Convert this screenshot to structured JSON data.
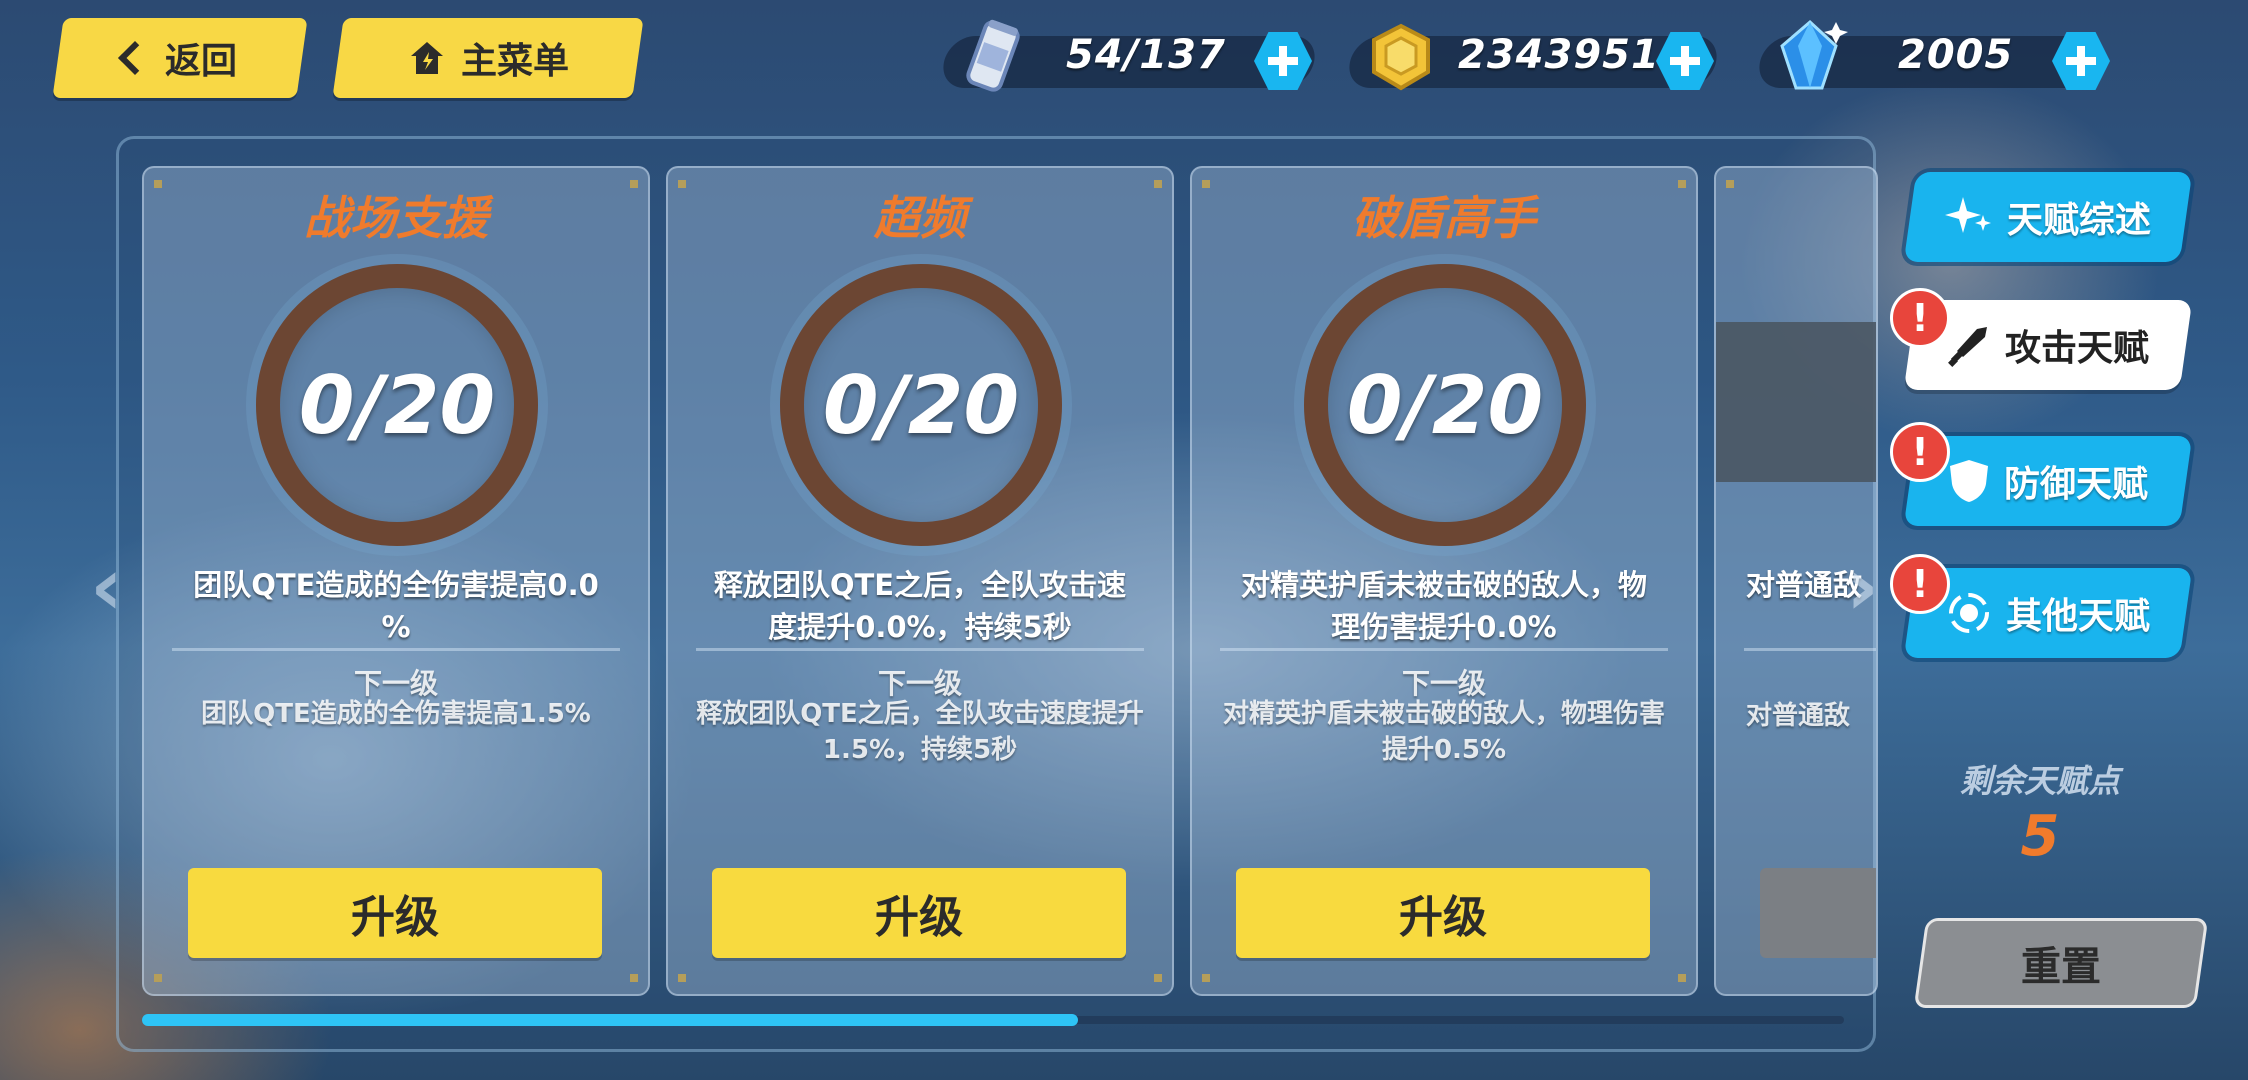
{
  "nav": {
    "back_label": "返回",
    "menu_label": "主菜单"
  },
  "resources": {
    "stamina": {
      "value": "54/137",
      "icon": "stamina-drink-icon"
    },
    "coins": {
      "value": "2343951",
      "icon": "coin-icon"
    },
    "crystals": {
      "value": "2005",
      "icon": "crystal-icon"
    }
  },
  "cards": [
    {
      "title": "战场支援",
      "level": "0/20",
      "progress": 0,
      "desc_line1": "团队QTE造成的全伤害提高0.0",
      "desc_line2": "%",
      "next_label": "下一级",
      "next_line1": "团队QTE造成的全伤害提高1.5%",
      "next_line2": "",
      "button": "升级"
    },
    {
      "title": "超频",
      "level": "0/20",
      "progress": 0,
      "desc_line1": "释放团队QTE之后，全队攻击速",
      "desc_line2": "度提升0.0%，持续5秒",
      "next_label": "下一级",
      "next_line1": "释放团队QTE之后，全队攻击速度提升",
      "next_line2": "1.5%，持续5秒",
      "button": "升级"
    },
    {
      "title": "破盾高手",
      "level": "0/20",
      "progress": 0,
      "desc_line1": "对精英护盾未被击破的敌人，物",
      "desc_line2": "理伤害提升0.0%",
      "next_label": "下一级",
      "next_line1": "对精英护盾未被击破的敌人，物理伤害",
      "next_line2": "提升0.5%",
      "button": "升级"
    }
  ],
  "partial_card": {
    "desc": "对普通敌",
    "next": "对普通敌"
  },
  "arrows": {
    "left": "‹",
    "right": "›"
  },
  "scroll_progress": 0.55,
  "side_tabs": [
    {
      "label": "天赋综述",
      "icon": "sparkle-icon",
      "alert": ""
    },
    {
      "label": "攻击天赋",
      "icon": "sword-icon",
      "alert": "!"
    },
    {
      "label": "防御天赋",
      "icon": "shield-icon",
      "alert": "!"
    },
    {
      "label": "其他天赋",
      "icon": "target-icon",
      "alert": "!"
    }
  ],
  "talent_points": {
    "label": "剩余天赋点",
    "value": "5"
  },
  "reset_label": "重置",
  "colors": {
    "accent_yellow": "#f8da3f",
    "accent_blue": "#19b4ee",
    "title_orange": "#f07b2c",
    "ring_brown": "#6c4633",
    "alert_red": "#e8453c"
  }
}
